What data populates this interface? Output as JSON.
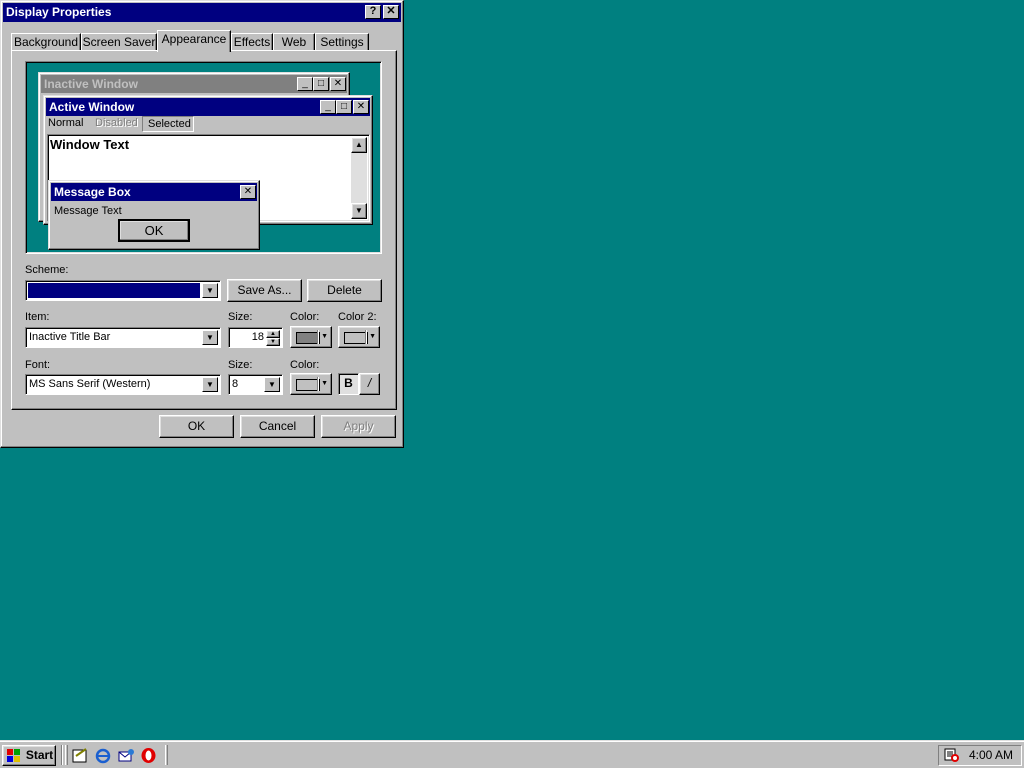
{
  "dialog": {
    "title": "Display Properties",
    "help_btn": "?",
    "close_btn": "✕",
    "tabs": [
      "Background",
      "Screen Saver",
      "Appearance",
      "Effects",
      "Web",
      "Settings"
    ],
    "active_tab": "Appearance"
  },
  "preview": {
    "inactive_title": "Inactive Window",
    "active_title": "Active Window",
    "menu": [
      "Normal",
      "Disabled",
      "Selected"
    ],
    "window_text": "Window Text",
    "msgbox_title": "Message Box",
    "msgbox_text": "Message Text",
    "msgbox_ok": "OK"
  },
  "form": {
    "scheme_label": "Scheme:",
    "scheme_value": "",
    "save_as": "Save As...",
    "delete": "Delete",
    "item_label": "Item:",
    "item_value": "Inactive Title Bar",
    "size_label": "Size:",
    "item_size": "18",
    "color_label": "Color:",
    "color2_label": "Color 2:",
    "font_label": "Font:",
    "font_value": "MS Sans Serif (Western)",
    "font_size_label": "Size:",
    "font_size": "8",
    "font_color_label": "Color:",
    "bold": "B",
    "italic": "/"
  },
  "buttons": {
    "ok": "OK",
    "cancel": "Cancel",
    "apply": "Apply"
  },
  "taskbar": {
    "start": "Start",
    "clock": "4:00 AM"
  },
  "colors": {
    "desktop": "#008080",
    "active_title": "#000080",
    "inactive_title": "#808080",
    "face": "#c0c0c0"
  }
}
